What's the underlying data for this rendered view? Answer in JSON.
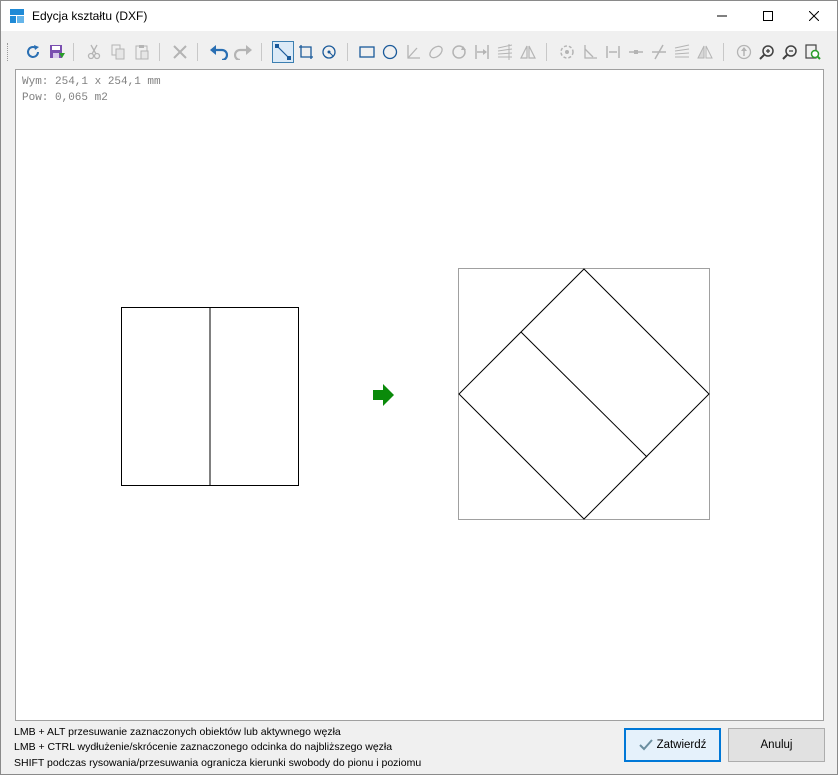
{
  "window": {
    "title": "Edycja kształtu (DXF)"
  },
  "toolbar": {
    "items": [
      {
        "name": "refresh-icon",
        "enabled": true
      },
      {
        "name": "save-icon",
        "enabled": true
      },
      {
        "name": "cut-icon",
        "enabled": false
      },
      {
        "name": "copy-icon",
        "enabled": false
      },
      {
        "name": "paste-icon",
        "enabled": false
      },
      {
        "name": "delete-icon",
        "enabled": false
      },
      {
        "name": "undo-icon",
        "enabled": true
      },
      {
        "name": "redo-icon",
        "enabled": false
      },
      {
        "name": "line-tool-icon",
        "enabled": true,
        "active": true
      },
      {
        "name": "polyline-tool-icon",
        "enabled": true
      },
      {
        "name": "arc-tool-icon",
        "enabled": true
      },
      {
        "name": "rectangle-tool-icon",
        "enabled": true
      },
      {
        "name": "circle-tool-icon",
        "enabled": true
      },
      {
        "name": "angle-tool-icon",
        "enabled": false
      },
      {
        "name": "ellipse-tool-icon",
        "enabled": false
      },
      {
        "name": "rotate-tool-icon",
        "enabled": false
      },
      {
        "name": "offset-tool-icon",
        "enabled": false
      },
      {
        "name": "hatch-tool-icon",
        "enabled": false
      },
      {
        "name": "mirror-tool-icon",
        "enabled": false
      },
      {
        "name": "rotate-selection-icon",
        "enabled": false
      },
      {
        "name": "corner-icon",
        "enabled": false
      },
      {
        "name": "extend-icon",
        "enabled": false
      },
      {
        "name": "split-icon",
        "enabled": false
      },
      {
        "name": "trim-icon",
        "enabled": false
      },
      {
        "name": "chamfer-icon",
        "enabled": false
      },
      {
        "name": "flip-icon",
        "enabled": false
      },
      {
        "name": "move-up-icon",
        "enabled": false
      },
      {
        "name": "zoom-in-icon",
        "enabled": true
      },
      {
        "name": "zoom-out-icon",
        "enabled": true
      },
      {
        "name": "zoom-fit-icon",
        "enabled": true
      }
    ]
  },
  "canvas": {
    "dimensions_text": "Wym: 254,1 x 254,1 mm",
    "area_text": "Pow: 0,065 m2",
    "colors": {
      "shape_stroke": "#000000",
      "bounding_box": "#a0a0a0",
      "arrow": "#0a8a0a"
    }
  },
  "help": {
    "line1": "LMB + ALT przesuwanie zaznaczonych obiektów lub aktywnego węzła",
    "line2": "LMB + CTRL wydłużenie/skrócenie zaznaczonego odcinka do najbliższego węzła",
    "line3": "SHIFT podczas rysowania/przesuwania ogranicza kierunki swobody do pionu i poziomu"
  },
  "buttons": {
    "confirm_label": "Zatwierdź",
    "cancel_label": "Anuluj"
  }
}
